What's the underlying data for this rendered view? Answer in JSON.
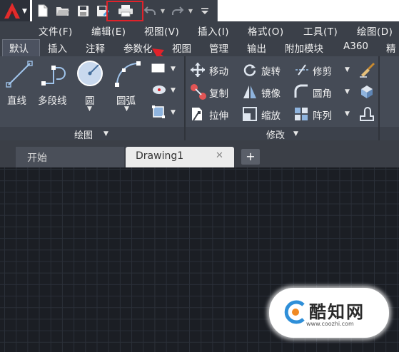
{
  "quick_access": {
    "icons": [
      "app-logo-icon",
      "new-file-icon",
      "open-folder-icon",
      "save-icon",
      "save-as-icon",
      "print-icon",
      "undo-icon",
      "redo-icon",
      "customize-icon"
    ]
  },
  "menu": {
    "items": [
      "文件(F)",
      "编辑(E)",
      "视图(V)",
      "插入(I)",
      "格式(O)",
      "工具(T)",
      "绘图(D)"
    ]
  },
  "ribbon_tabs": [
    "默认",
    "插入",
    "注释",
    "参数化",
    "视图",
    "管理",
    "输出",
    "附加模块",
    "A360",
    "精"
  ],
  "draw_panel": {
    "title": "绘图",
    "tools": [
      "直线",
      "多段线",
      "圆",
      "圆弧"
    ]
  },
  "modify_panel": {
    "title": "修改",
    "tools": [
      "移动",
      "旋转",
      "修剪",
      "复制",
      "镜像",
      "圆角",
      "拉伸",
      "缩放",
      "阵列"
    ]
  },
  "file_tabs": {
    "start": "开始",
    "drawing": "Drawing1",
    "close": "✕",
    "add": "+"
  },
  "watermark": {
    "text": "酷知网",
    "url": "www.coozhi.com"
  },
  "colors": {
    "accent_red": "#e0222a",
    "ribbon_bg": "#454b56",
    "canvas_bg": "#1b1e24"
  }
}
